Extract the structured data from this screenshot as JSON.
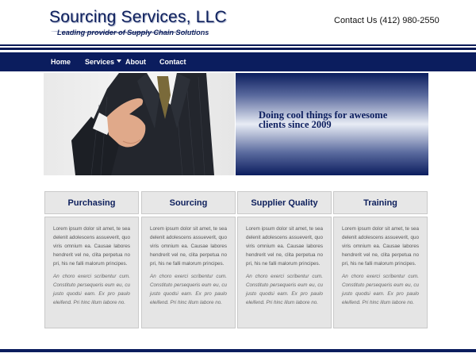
{
  "header": {
    "logo_title": "Sourcing Services, LLC",
    "logo_tagline": "Leading provider of Supply Chain Solutions",
    "contact": "Contact Us (412) 980-2550"
  },
  "nav": {
    "items": [
      {
        "label": "Home"
      },
      {
        "label": "Services"
      },
      {
        "label": "About"
      },
      {
        "label": "Contact"
      }
    ]
  },
  "hero": {
    "tagline_line1": "Doing cool things for awesome",
    "tagline_line2": "clients since 2009"
  },
  "cards": [
    {
      "title": "Purchasing",
      "p1": "Lorem ipsum dolor sit amet, te sea delenit adolescens assueverit, quo viris omnium ea. Causae labores hendrerit vel ne, clita perpetua no pri, his ne falli malorum principes.",
      "p2": "An choro exerci scribentur cum. Constituto persequeris eum eu, cu justo quodsi eam. Ex pro paulo eleifend. Pri hinc illum labore no."
    },
    {
      "title": "Sourcing",
      "p1": "Lorem ipsum dolor sit amet, te sea delenit adolescens assueverit, quo viris omnium ea. Causae labores hendrerit vel ne, clita perpetua no pri, his ne falli malorum principes.",
      "p2": "An choro exerci scribentur cum. Constituto persequeris eum eu, cu justo quodsi eam. Ex pro paulo eleifend. Pri hinc illum labore no."
    },
    {
      "title": "Supplier Quality",
      "p1": "Lorem ipsum dolor sit amet, te sea delenit adolescens assueverit, quo viris omnium ea. Causae labores hendrerit vel ne, clita perpetua no pri, his ne falli malorum principes.",
      "p2": "An choro exerci scribentur cum. Constituto persequeris eum eu, cu justo quodsi eam. Ex pro paulo eleifend. Pri hinc illum labore no."
    },
    {
      "title": "Training",
      "p1": "Lorem ipsum dolor sit amet, te sea delenit adolescens assueverit, quo viris omnium ea. Causae labores hendrerit vel ne, clita perpetua no pri, his ne falli malorum principes.",
      "p2": "An choro exerci scribentur cum. Constituto persequeris eum eu, cu justo quodsi eam. Ex pro paulo eleifend. Pri hinc illum labore no."
    }
  ],
  "colors": {
    "brand_navy": "#0b1d5e",
    "card_bg": "#e5e5e5",
    "card_border": "#c9c9c9"
  },
  "icons": {
    "services_dropdown": "caret-down-icon"
  }
}
